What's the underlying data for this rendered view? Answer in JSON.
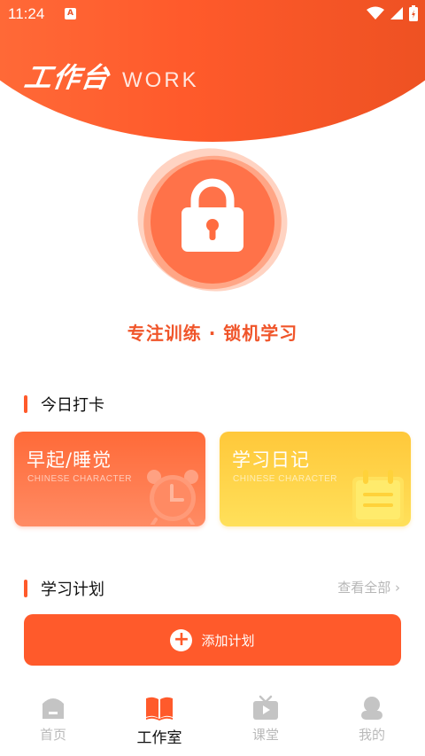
{
  "status_bar": {
    "time": "11:24",
    "notification_glyph": "A"
  },
  "header": {
    "title_cn": "工作台",
    "title_en": "WORK"
  },
  "focus": {
    "label": "专注训练 · 锁机学习"
  },
  "checkin": {
    "section_title": "今日打卡",
    "cards": [
      {
        "title": "早起/睡觉",
        "subtitle": "CHINESE CHARACTER",
        "icon": "alarm-clock-icon"
      },
      {
        "title": "学习日记",
        "subtitle": "CHINESE CHARACTER",
        "icon": "notepad-icon"
      }
    ]
  },
  "plan": {
    "section_title": "学习计划",
    "view_all": "查看全部 ›",
    "add_label": "添加计划"
  },
  "tabs": [
    {
      "label": "首页",
      "icon": "home-icon",
      "active": false
    },
    {
      "label": "工作室",
      "icon": "book-icon",
      "active": true
    },
    {
      "label": "课堂",
      "icon": "tv-icon",
      "active": false
    },
    {
      "label": "我的",
      "icon": "profile-icon",
      "active": false
    }
  ],
  "colors": {
    "accent": "#ff5a2b",
    "yellow": "#ffc83a",
    "inactive": "#b9b9b9"
  }
}
